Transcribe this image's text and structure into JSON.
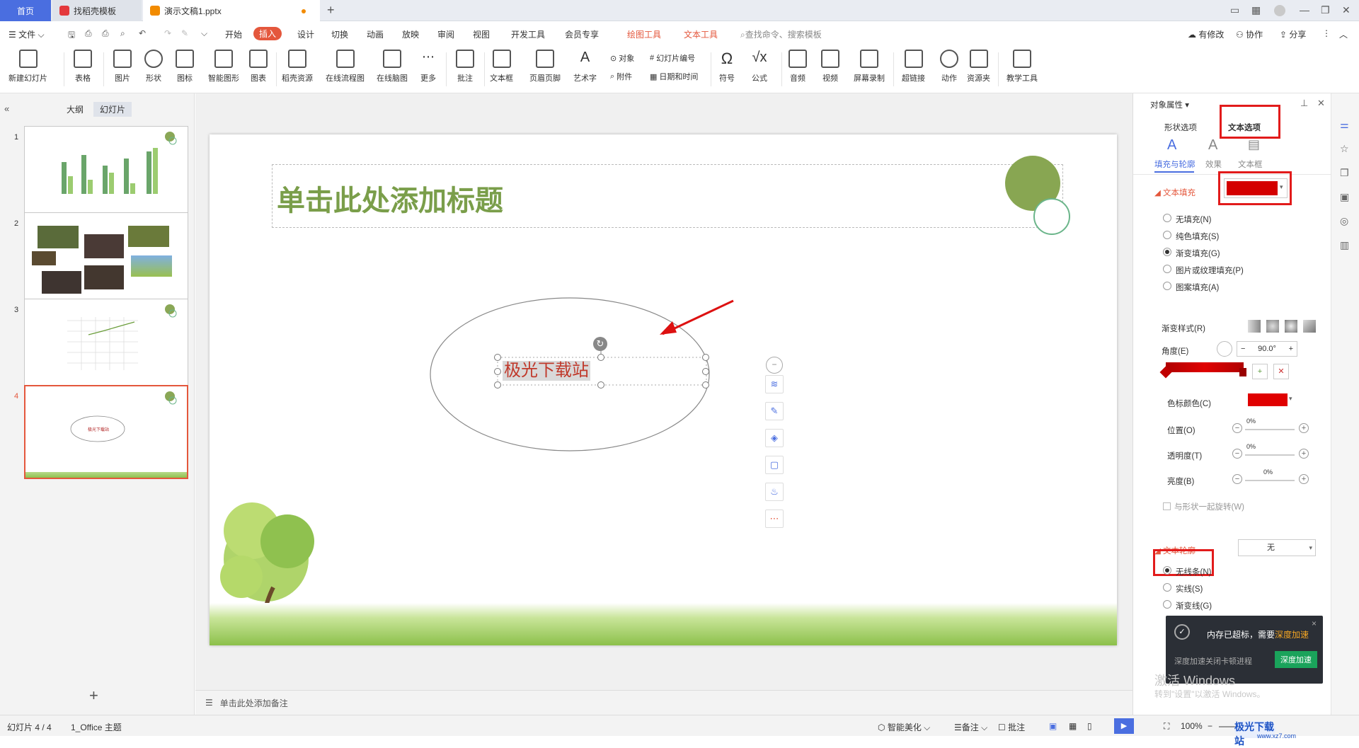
{
  "tabs": {
    "home": "首页",
    "template": "找稻壳模板",
    "document": "演示文稿1.pptx",
    "new_tab": "+"
  },
  "menu": {
    "file": "文件",
    "items": [
      "开始",
      "插入",
      "设计",
      "切换",
      "动画",
      "放映",
      "审阅",
      "视图",
      "开发工具",
      "会员专享"
    ],
    "drawing_tools": "绘图工具",
    "text_tools": "文本工具",
    "search_placeholder": "查找命令、搜索模板",
    "has_changes": "有修改",
    "collaborate": "协作",
    "share": "分享"
  },
  "ribbon": {
    "new_slide": "新建幻灯片",
    "table": "表格",
    "picture": "图片",
    "shape": "形状",
    "icon": "图标",
    "smart_art": "智能图形",
    "chart": "图表",
    "docer_resource": "稻壳资源",
    "online_flowchart": "在线流程图",
    "online_mindmap": "在线脑图",
    "more": "更多",
    "comment": "批注",
    "textbox": "文本框",
    "header_footer": "页眉页脚",
    "wordart": "艺术字",
    "object": "对象",
    "attachment": "附件",
    "slide_number": "幻灯片编号",
    "datetime": "日期和时间",
    "symbol": "符号",
    "formula": "公式",
    "audio": "音频",
    "video": "视频",
    "screen_record": "屏幕录制",
    "hyperlink": "超链接",
    "action": "动作",
    "resource_folder": "资源夹",
    "teaching_tools": "教学工具"
  },
  "left_panel": {
    "outline_tab": "大纲",
    "slides_tab": "幻灯片",
    "slide_numbers": [
      "1",
      "2",
      "3",
      "4"
    ],
    "add": "+"
  },
  "slide": {
    "title_placeholder": "单击此处添加标题",
    "textbox_text": "极光下载站",
    "thumb4_text": "极光下载站"
  },
  "notes": {
    "placeholder": "单击此处添加备注"
  },
  "right_panel": {
    "header": "对象属性",
    "tab_shape": "形状选项",
    "tab_text": "文本选项",
    "sub_fill": "填充与轮廓",
    "sub_effect": "效果",
    "sub_textbox": "文本框",
    "text_fill_section": "文本填充",
    "fill_color": "#d40000",
    "fill_options": [
      "无填充(N)",
      "纯色填充(S)",
      "渐变填充(G)",
      "图片或纹理填充(P)",
      "图案填充(A)"
    ],
    "fill_selected_index": 2,
    "gradient_style": "渐变样式(R)",
    "angle_label": "角度(E)",
    "angle_value": "90.0°",
    "stop_color_label": "色标颜色(C)",
    "position_label": "位置(O)",
    "position_value": "0%",
    "transparency_label": "透明度(T)",
    "transparency_value": "0%",
    "brightness_label": "亮度(B)",
    "brightness_value": "0%",
    "rotate_with_shape": "与形状一起旋转(W)",
    "outline_section": "文本轮廓",
    "outline_value": "无",
    "outline_options": [
      "无线条(N)",
      "实线(S)",
      "渐变线(G)"
    ],
    "outline_selected_index": 0
  },
  "notification": {
    "title": "内存已超标，需要",
    "highlight": "深度加速",
    "subtitle": "深度加速关闭卡顿进程",
    "button": "深度加速",
    "close": "×"
  },
  "watermark": {
    "line1": "激活 Windows",
    "line2": "转到\"设置\"以激活 Windows。"
  },
  "status": {
    "slide_counter": "幻灯片 4 / 4",
    "theme": "1_Office 主题",
    "smart_beautify": "智能美化",
    "notes": "备注",
    "comment": "批注",
    "zoom": "100%"
  },
  "logo": {
    "text": "极光下载站",
    "url_text": "www.xz7.com"
  }
}
